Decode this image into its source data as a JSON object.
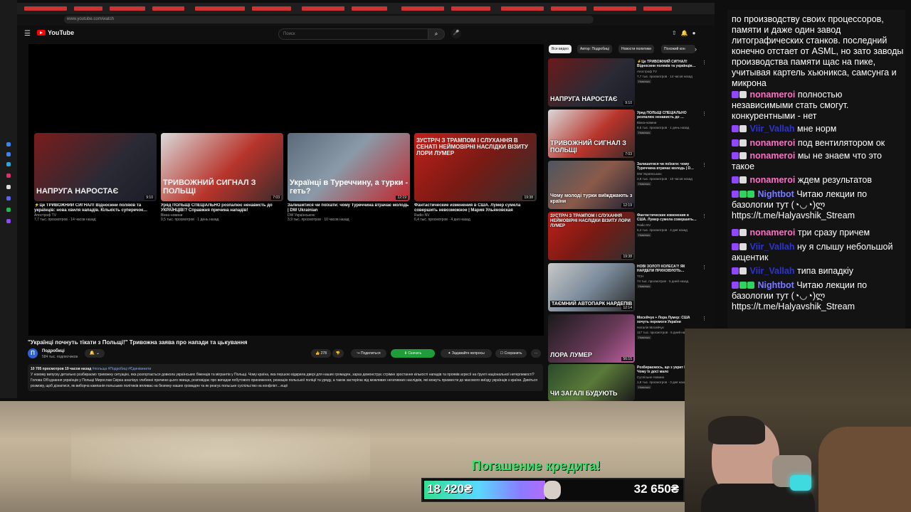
{
  "browser": {
    "url": "www.youtube.com/watch"
  },
  "youtube": {
    "logo": "YouTube",
    "search_placeholder": "Поиск"
  },
  "end_cards": [
    {
      "thumb_text": "НАПРУГА НАРОСТАЄ",
      "duration": "9:10",
      "title": "⚡Це ТРИВОЖНИЙ СИГНАЛ! Відносини поляків та українців: нова хвиля нападів. Кількість суперечок…",
      "channel": "Апостроф TV",
      "meta": "7,7 тыс. просмотров · 14 часов назад"
    },
    {
      "thumb_text": "ТРИВОЖНИЙ СИГНАЛ З ПОЛЬЩІ",
      "duration": "7:03",
      "title": "Уряд ПОЛЬЩІ СПЕЦІАЛЬНО розпалює ненависть до УКРАЇНЦІВ!? Справжня причина нападів!",
      "channel": "Вікна-новини",
      "meta": "9,5 тыс. просмотров · 1 день назад"
    },
    {
      "thumb_text": "Українці в Туреччину, а турки - геть?",
      "duration": "12:19",
      "title": "Залишитися чи поїхати: чому Туреччина втрачає молодь | DW Ukrainian",
      "channel": "DW Українською",
      "meta": "3,9 тыс. просмотров · 10 часов назад"
    },
    {
      "thumb_text": "ЗУСТРІЧ З ТРАМПОМ І СЛУХАННЯ В СЕНАТІ НЕЙМОВІРНІ НАСЛІДКИ ВІЗИТУ ЛОРИ ЛУМЕР",
      "duration": "19:38",
      "title": "Фантастические изменения в США. Лумер сумела совершить невозможное | Мария Ульяновская",
      "channel": "Radio NV",
      "meta": "6,4 тыс. просмотров · 4 дня назад"
    }
  ],
  "video": {
    "title": "\"Українці почнуть тікати з Польщі!\" Тривожна заява про напади та цькування",
    "channel": "Подробиці",
    "subs": "584 тыс. подписчиков",
    "avatar_letter": "П",
    "likes": "278",
    "share": "Поделиться",
    "download": "Скачать",
    "ask": "Задавайте вопросы",
    "save": "Сохранить",
    "views_date": "10 705 просмотров  19 часов назад",
    "tags": "#польща #Подробиці #Єдинівинити",
    "description": "У новому випуску детально розбираємо тривожну ситуацію, яка розгортається довкола українських біженців та мігрантів у Польщі. Чому країна, яка першою відкрила двері для наших громадян, зараз демонструє стрімке зростання кількості нападів та проявів агресії на ґрунті національної нетерпимості? Голова Об'єднання українців у Польщі Мирослав Скірка аналізує глибинні причини цього явища, розповідає про випадки побутового приниження, резкацію польської поліції та уряду, а також застерігає від можливих негативних наслідків, які можуть призвести до масового виїзду українців з країни. Дивіться розмову, щоб дізнатися, як виборча кампанія польських політиків впливає на безпеку наших громадян та як реагує польське суспільство на конфлікт…ещё"
  },
  "chips": [
    "Все видео",
    "Автор: Подробиці",
    "Новости политики",
    "Похожий кон"
  ],
  "recommendations": [
    {
      "thumb_text": "НАПРУГА НАРОСТАЄ",
      "duration": "9:10",
      "title": "⚡Це ТРИВОЖНИЙ СИГНАЛ! Відносини поляків та українців…",
      "channel": "Апостроф TV",
      "meta": "7,7 тыс. просмотров · 14 часов назад",
      "badge": "Новинка"
    },
    {
      "thumb_text": "ТРИВОЖНИЙ СИГНАЛ З ПОЛЬЩІ",
      "duration": "7:03",
      "title": "Уряд ПОЛЬЩІ СПЕЦІАЛЬНО розпалює ненависть до …",
      "channel": "Вікна-новини",
      "meta": "9,5 тыс. просмотров · 1 день назад",
      "badge": "Новинка"
    },
    {
      "thumb_text": "Чому молоді турки виїжджають з країни",
      "duration": "12:19",
      "title": "Залишитися чи поїхати: чому Туреччина втрачає молодь | D…",
      "channel": "DW Українською",
      "meta": "3,9 тыс. просмотров · 10 часов назад",
      "badge": "Новинка"
    },
    {
      "thumb_text": "ЗУСТРІЧ З ТРАМПОМ І СЛУХАННЯ НЕЙМОВІРНІ НАСЛІДКИ ВІЗИТУ ЛОРИ ЛУМЕР",
      "duration": "19:38",
      "title": "Фантастические изменения в США. Лумер сумела совершить…",
      "channel": "Radio NV",
      "meta": "6,4 тыс. просмотров · 4 дня назад",
      "badge": "Новинка"
    },
    {
      "thumb_text": "ТАЄМНИЙ АВТОПАРК НАРДЕПІВ",
      "duration": "12:14",
      "title": "НОВІ ЗОЛОТІ КОЛЕСА?! ЯК НАРДЕПИ ПРИХОВУЮТЬ…",
      "channel": "ТСН",
      "meta": "74 тыс. просмотров · 5 дней назад",
      "badge": "Новинка"
    },
    {
      "thumb_text": "ЛОРА ЛУМЕР",
      "duration": "56:15",
      "title": "Мосейчук + Лора Лумер: США хочуть перемоги України",
      "channel": "Наталія Мосейчук",
      "meta": "117 тыс. просмотров · 5 дней назад",
      "badge": "Новинка"
    },
    {
      "thumb_text": "ЧИ ЗАГАЛІ БУДУЮТЬ",
      "duration": "",
      "title": "Розбираємось, що з укрит Києва | Чому їх досі мало",
      "channel": "Суспільне Новини",
      "meta": "1,8 тыс. просмотров · 3 дня назад",
      "badge": "Новинка"
    }
  ],
  "chat": [
    {
      "name": "",
      "text": "по производству своих процессоров, памяти и даже один завод литографических станков. последний конечно отстает от ASML, но зато заводы производства памяти щас на пике, учитывая картель хьюникса, самсунга и микрона",
      "color": "#ffffff"
    },
    {
      "name": "nonameroi",
      "text": "полностью независимыми стать смогут. конкурентными - нет",
      "color": "#ff6fc8"
    },
    {
      "name": "Viir_Vallah",
      "text": "мне норм",
      "color": "#2e36c9"
    },
    {
      "name": "nonameroi",
      "text": "под вентилятором ок",
      "color": "#ff6fc8"
    },
    {
      "name": "nonameroi",
      "text": "мы не знаем что это такое",
      "color": "#ff6fc8"
    },
    {
      "name": "nonameroi",
      "text": "ждем результатов",
      "color": "#ff6fc8"
    },
    {
      "name": "Nightbot",
      "text": "Читаю лекции по базологии тут (◔◡◔)ლ https://t.me/Halyavshik_Stream",
      "color": "#7b7bff"
    },
    {
      "name": "nonameroi",
      "text": "три сразу причем",
      "color": "#ff6fc8"
    },
    {
      "name": "Viir_Vallah",
      "text": "ну я слышу небольшой акцентик",
      "color": "#2e36c9"
    },
    {
      "name": "Viir_Vallah",
      "text": "типа випадкiу",
      "color": "#2e36c9"
    },
    {
      "name": "Nightbot",
      "text": "Читаю лекции по базологии тут (◔◡◔)ლ https://t.me/Halyavshik_Stream",
      "color": "#7b7bff"
    }
  ],
  "goal": {
    "title": "Погашение кредита!",
    "current": "18 420₴",
    "target": "32 650₴",
    "progress": 0.564
  }
}
